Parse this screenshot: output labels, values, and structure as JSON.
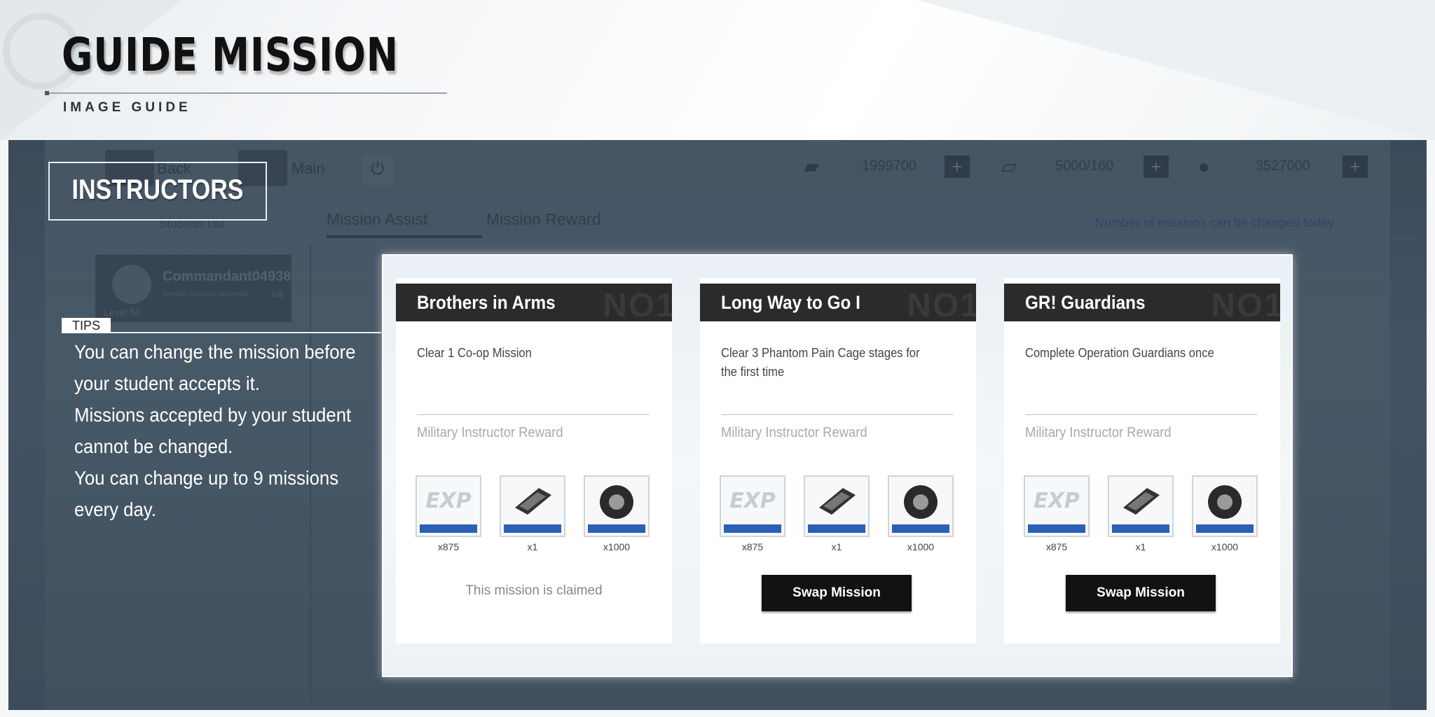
{
  "guide": {
    "title": "GUIDE MISSION",
    "subtitle": "IMAGE GUIDE"
  },
  "topbar": {
    "back_label": "Back",
    "main_label": "Main",
    "resources": [
      {
        "icon": "ticket-icon",
        "value": "1999700"
      },
      {
        "icon": "stamina-icon",
        "value": "5000/160"
      },
      {
        "icon": "coin-icon",
        "value": "3527000"
      }
    ]
  },
  "tabs": {
    "assist": "Mission Assist",
    "reward": "Mission Reward",
    "changes_note": "Number of missions can be changed today"
  },
  "students": {
    "list_label": "Students List",
    "name": "Commandant04938",
    "progress_label": "Weekly mission progress",
    "progress_count": "0/8",
    "level": "Level 50"
  },
  "overlay": {
    "instructors_label": "INSTRUCTORS",
    "tips_badge": "TIPS",
    "tips_lines": [
      "You can change the mission before your student accepts it.",
      "Missions accepted by your student cannot be changed.",
      "You can change up to 9 missions every day."
    ]
  },
  "missions": [
    {
      "title": "Brothers in Arms",
      "badge": "NO1",
      "description": "Clear 1 Co-op Mission",
      "reward_label": "Military Instructor Reward",
      "items": [
        {
          "icon": "exp-supply-icon",
          "qty": "x875"
        },
        {
          "icon": "chip-supply-icon",
          "qty": "x1"
        },
        {
          "icon": "gear-supply-icon",
          "qty": "x1000"
        }
      ],
      "status": "This mission is claimed"
    },
    {
      "title": "Long Way to Go I",
      "badge": "NO1",
      "description": "Clear 3 Phantom Pain Cage stages for the first time",
      "reward_label": "Military Instructor Reward",
      "items": [
        {
          "icon": "exp-supply-icon",
          "qty": "x875"
        },
        {
          "icon": "chip-supply-icon",
          "qty": "x1"
        },
        {
          "icon": "gear-supply-icon",
          "qty": "x1000"
        }
      ],
      "button": "Swap Mission"
    },
    {
      "title": "GR! Guardians",
      "badge": "NO1",
      "description": "Complete Operation Guardians once",
      "reward_label": "Military Instructor Reward",
      "items": [
        {
          "icon": "exp-supply-icon",
          "qty": "x875"
        },
        {
          "icon": "chip-supply-icon",
          "qty": "x1"
        },
        {
          "icon": "gear-supply-icon",
          "qty": "x1000"
        }
      ],
      "button": "Swap Mission"
    }
  ],
  "colors": {
    "screen_bg": "#3f4e5d",
    "card_header": "#2b2b2b",
    "button_bg": "#121212",
    "supply_strip": "#2d5fb5"
  }
}
